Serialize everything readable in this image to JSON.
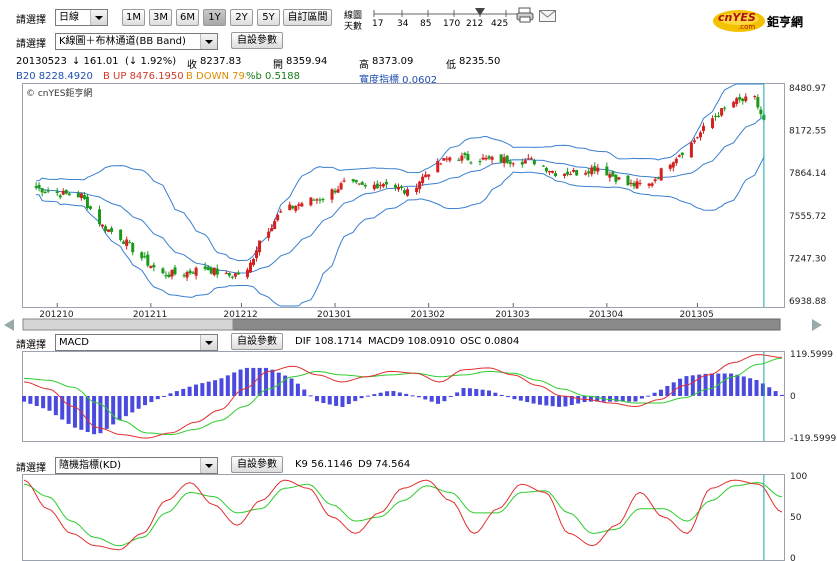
{
  "toolbar": {
    "select_label": "請選擇",
    "period_value": "日線",
    "ranges": [
      "1M",
      "3M",
      "6M",
      "1Y",
      "2Y",
      "5Y"
    ],
    "active_range": "1Y",
    "custom_range": "自訂區間",
    "ma_label_1": "線圖",
    "ma_label_2": "天數",
    "ma_ticks": [
      "17",
      "34",
      "85",
      "170",
      "212",
      "425"
    ],
    "indicator_value": "K線圖＋布林通道(BB Band)",
    "settings_label": "自設參數"
  },
  "logo": {
    "brand": "cnYES",
    "sub": ".com",
    "name": "鉅亨網"
  },
  "quote": {
    "date": "20130523",
    "change": "↓ 161.01",
    "change_pct": "(↓ 1.92%)",
    "close_label": "收",
    "close": "8237.83",
    "open_label": "開",
    "open": "8359.94",
    "high_label": "高",
    "high": "8373.09",
    "low_label": "低",
    "low": "8235.50"
  },
  "bb": {
    "b20": "B20 8228.4920",
    "up": "B UP 8476.1950",
    "down": "B DOWN 7980.78",
    "pctb": "%b 0.5188",
    "width": "寬度指標 0.0602",
    "colors": {
      "b20": "#1f4fb0",
      "up": "#d23a2a",
      "down": "#e08a00",
      "pctb": "#1a7a1a",
      "width": "#1f4fb0"
    }
  },
  "watermark": "© cnYES鉅亨網",
  "macd": {
    "select_value": "MACD",
    "dif": "DIF 108.1714",
    "macd9": "MACD9 108.0910",
    "osc": "OSC 0.0804"
  },
  "kd": {
    "select_value": "隨機指標(KD)",
    "k9": "K9 56.1146",
    "d9": "D9 74.564"
  },
  "colors": {
    "up": "#d42020",
    "down": "#1a9a1a",
    "band": "#3a7fd0",
    "dif": "#e03030",
    "macd9": "#2ecc2e",
    "osc": "#4a4ae0",
    "cursor": "#1aa6a6"
  },
  "chart_data": [
    {
      "type": "candlestick",
      "title": "K線圖＋布林通道(BB Band)",
      "x_ticks": [
        "201210",
        "201211",
        "201212",
        "201301",
        "201302",
        "201303",
        "201304",
        "201305"
      ],
      "y_ticks": [
        6938.88,
        7247.3,
        7555.72,
        7864.14,
        8172.55,
        8480.97
      ],
      "ylim": [
        6938.88,
        8480.97
      ],
      "close_trend": [
        {
          "x": "2012-09-24",
          "close": 7760
        },
        {
          "x": "2012-10-02",
          "close": 7715
        },
        {
          "x": "2012-10-09",
          "close": 7700
        },
        {
          "x": "2012-10-16",
          "close": 7480
        },
        {
          "x": "2012-10-22",
          "close": 7400
        },
        {
          "x": "2012-10-30",
          "close": 7230
        },
        {
          "x": "2012-11-05",
          "close": 7130
        },
        {
          "x": "2012-11-12",
          "close": 7140
        },
        {
          "x": "2012-11-19",
          "close": 7180
        },
        {
          "x": "2012-11-26",
          "close": 7120
        },
        {
          "x": "2012-12-03",
          "close": 7150
        },
        {
          "x": "2012-12-07",
          "close": 7380
        },
        {
          "x": "2012-12-14",
          "close": 7580
        },
        {
          "x": "2012-12-21",
          "close": 7650
        },
        {
          "x": "2012-12-28",
          "close": 7690
        },
        {
          "x": "2013-01-04",
          "close": 7790
        },
        {
          "x": "2013-01-11",
          "close": 7760
        },
        {
          "x": "2013-01-18",
          "close": 7800
        },
        {
          "x": "2013-01-25",
          "close": 7720
        },
        {
          "x": "2013-02-01",
          "close": 7880
        },
        {
          "x": "2013-02-08",
          "close": 7980
        },
        {
          "x": "2013-02-22",
          "close": 7960
        },
        {
          "x": "2013-03-01",
          "close": 7960
        },
        {
          "x": "2013-03-08",
          "close": 7950
        },
        {
          "x": "2013-03-15",
          "close": 7870
        },
        {
          "x": "2013-03-22",
          "close": 7870
        },
        {
          "x": "2013-03-29",
          "close": 7910
        },
        {
          "x": "2013-04-08",
          "close": 7780
        },
        {
          "x": "2013-04-15",
          "close": 7780
        },
        {
          "x": "2013-04-22",
          "close": 7950
        },
        {
          "x": "2013-04-29",
          "close": 8080
        },
        {
          "x": "2013-05-06",
          "close": 8260
        },
        {
          "x": "2013-05-13",
          "close": 8380
        },
        {
          "x": "2013-05-20",
          "close": 8400
        },
        {
          "x": "2013-05-23",
          "close": 8237.83
        }
      ],
      "band_upper_end": 8476.195,
      "band_mid_end": 8228.492,
      "band_lower_end": 7980.78
    },
    {
      "type": "line+bar",
      "title": "MACD",
      "y_ticks": [
        119.5999,
        0,
        -119.5999
      ],
      "ylim": [
        -119.5999,
        119.5999
      ],
      "series": [
        {
          "name": "DIF",
          "values": [
            40,
            20,
            -30,
            -90,
            -110,
            -120,
            -105,
            -75,
            -40,
            20,
            70,
            85,
            60,
            40,
            55,
            70,
            65,
            40,
            75,
            80,
            60,
            30,
            0,
            -10,
            -20,
            -30,
            -10,
            30,
            60,
            95,
            118,
            110
          ]
        },
        {
          "name": "MACD9",
          "values": [
            50,
            45,
            25,
            -20,
            -70,
            -105,
            -110,
            -95,
            -70,
            -30,
            20,
            55,
            70,
            60,
            55,
            60,
            65,
            55,
            60,
            70,
            65,
            45,
            20,
            0,
            -10,
            -20,
            -20,
            -5,
            20,
            55,
            90,
            108
          ]
        }
      ]
    },
    {
      "type": "line",
      "title": "隨機指標(KD)",
      "y_ticks": [
        100,
        50,
        0
      ],
      "ylim": [
        0,
        100
      ],
      "series": [
        {
          "name": "K9",
          "values": [
            95,
            60,
            30,
            15,
            10,
            30,
            70,
            92,
            65,
            40,
            70,
            95,
            85,
            50,
            30,
            55,
            85,
            95,
            70,
            30,
            60,
            90,
            80,
            30,
            15,
            40,
            80,
            50,
            30,
            85,
            95,
            90,
            56
          ]
        },
        {
          "name": "D9",
          "values": [
            90,
            75,
            45,
            25,
            15,
            25,
            55,
            80,
            75,
            55,
            60,
            85,
            90,
            65,
            45,
            50,
            70,
            88,
            80,
            55,
            55,
            80,
            82,
            55,
            30,
            35,
            60,
            60,
            45,
            70,
            88,
            92,
            74.5
          ]
        }
      ]
    }
  ]
}
